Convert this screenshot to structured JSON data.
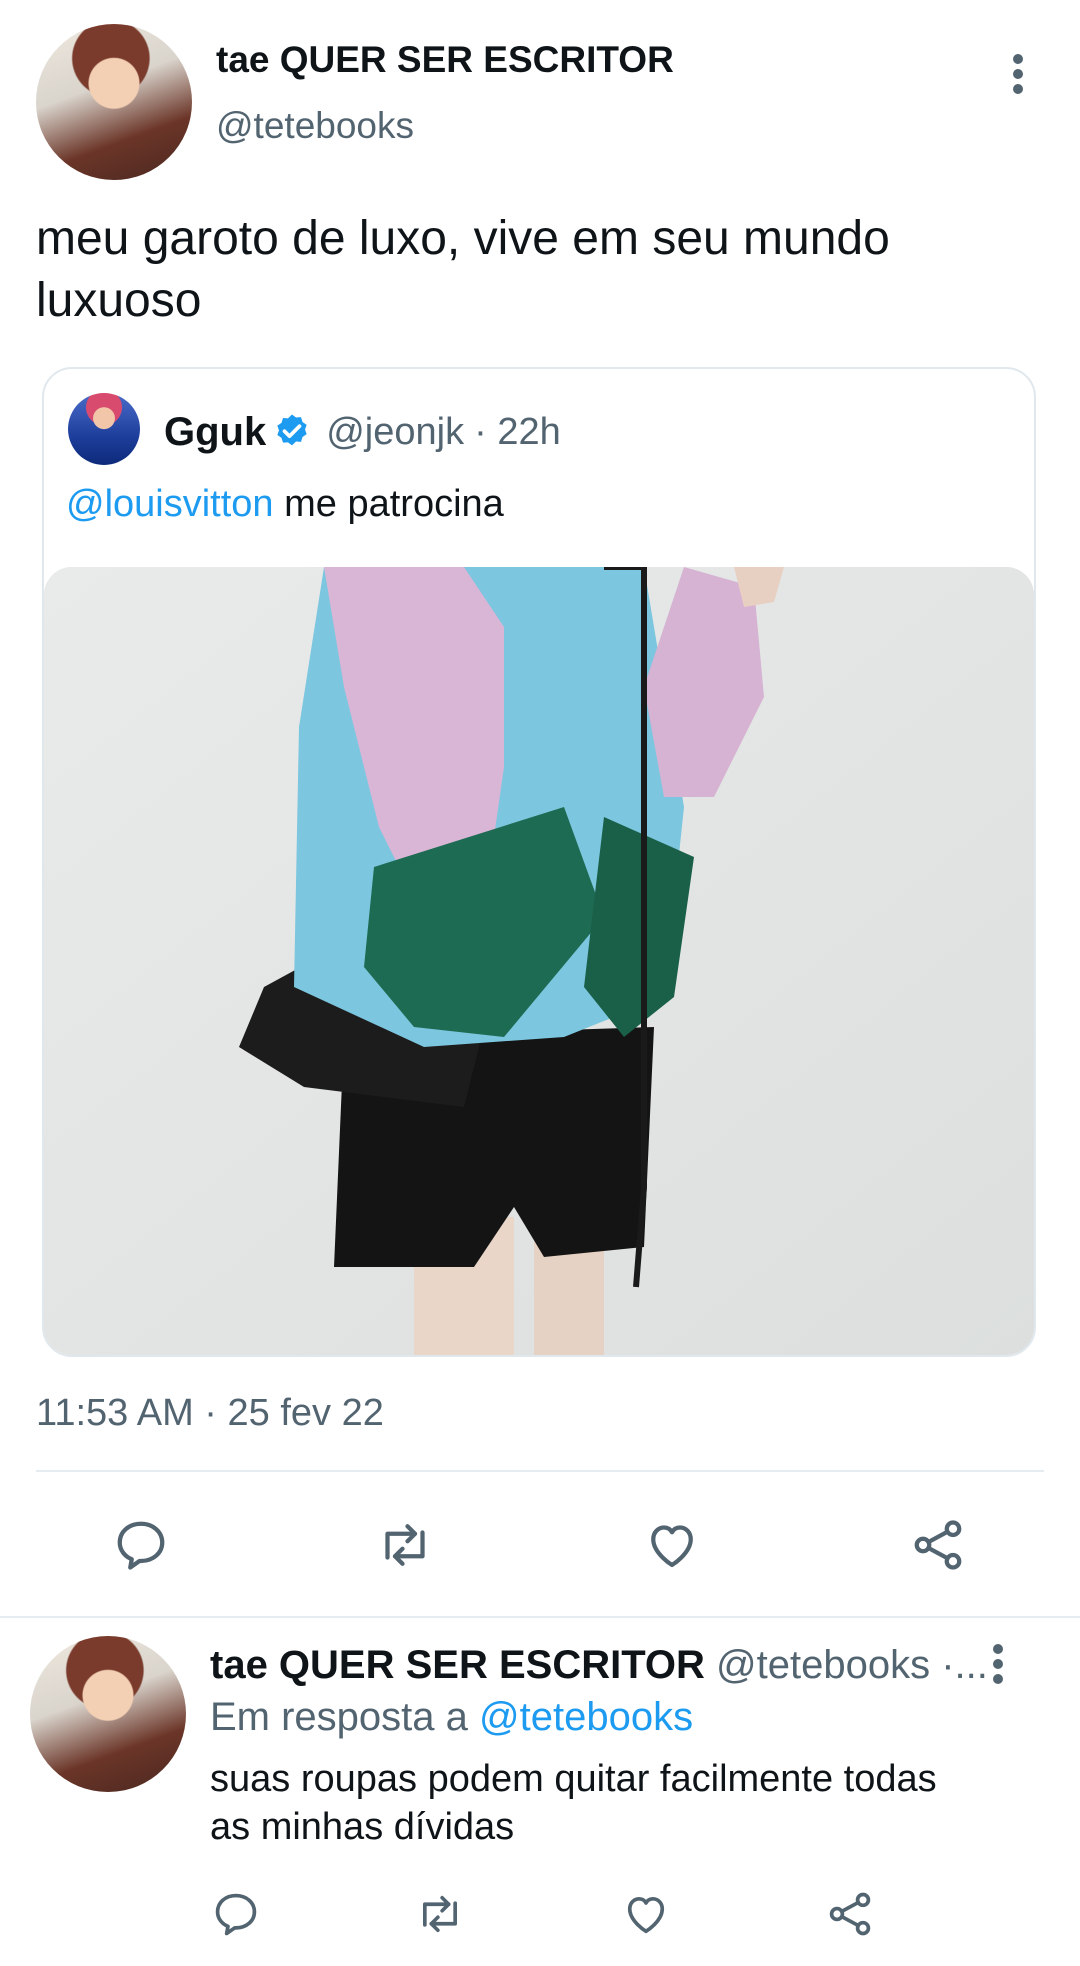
{
  "tweet": {
    "author_name": "tae QUER SER ESCRITOR",
    "author_handle": "@tetebooks",
    "text": "meu garoto de luxo,  vive em seu mundo luxuoso",
    "timestamp": "11:53 AM · 25 fev 22"
  },
  "quote": {
    "author_name": "Gguk",
    "author_handle": "@jeonjk",
    "time": "· 22h",
    "mention": "@louisvitton",
    "text": " me patrocina"
  },
  "reply": {
    "author_name": "tae QUER SER ESCRITOR",
    "author_handle": "@tetebooks ·...",
    "in_reply_prefix": "Em resposta a ",
    "in_reply_handle": "@tetebooks",
    "text": "suas roupas podem quitar facilmente todas as minhas dívidas"
  },
  "colors": {
    "accent": "#1d9bf0",
    "muted": "#536471",
    "divider": "#eff3f4"
  },
  "icons": [
    "more-vert-icon",
    "verified-badge-icon",
    "reply-icon",
    "retweet-icon",
    "like-icon",
    "share-icon"
  ]
}
